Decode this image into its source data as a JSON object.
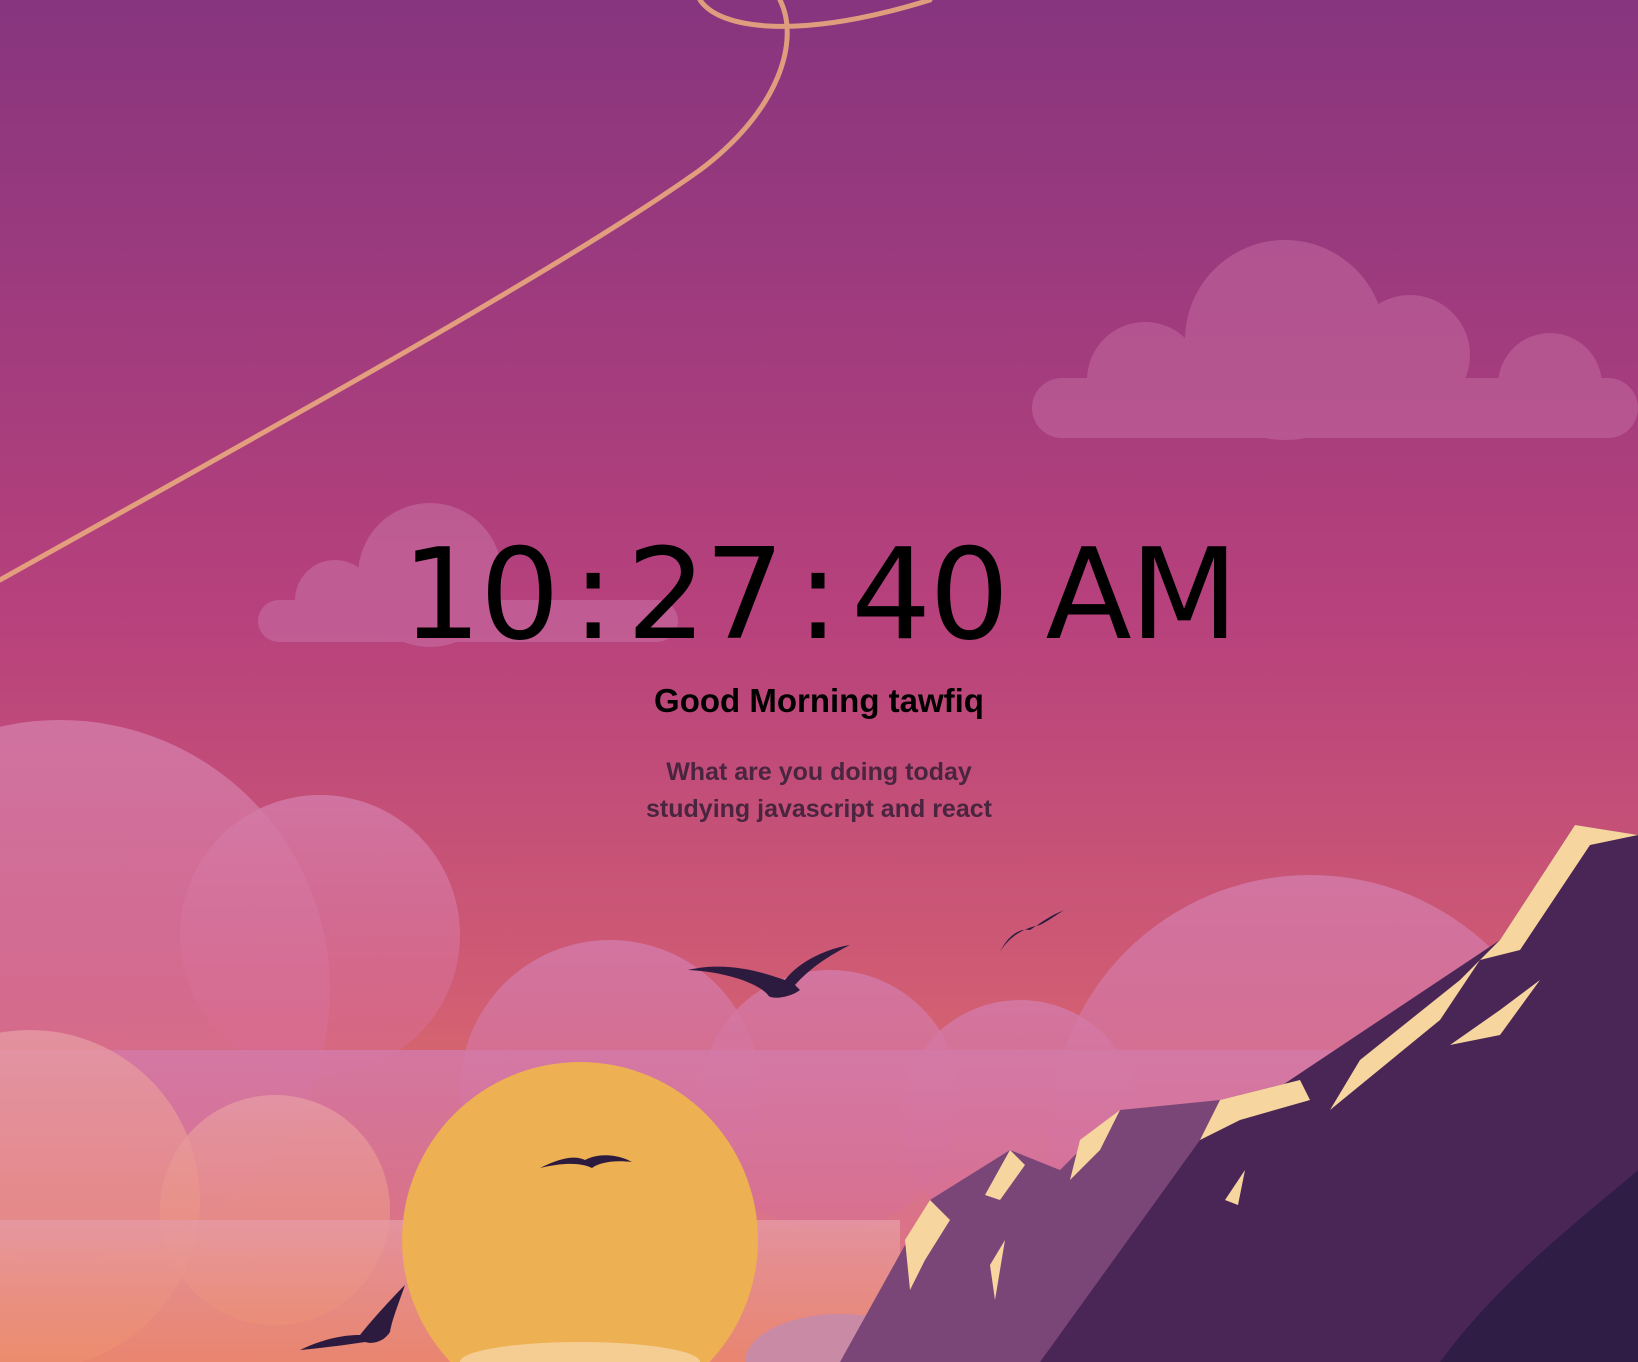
{
  "clock": {
    "hours": "10",
    "separator": ":",
    "minutes": "27",
    "seconds": "40",
    "period": "AM"
  },
  "greeting": "Good Morning tawfiq",
  "focus": {
    "question": "What are you doing today",
    "answer": "studying javascript and react"
  },
  "colors": {
    "sky_top": "#87357f",
    "sky_mid": "#b8417c",
    "sky_low": "#d66872",
    "horizon": "#ec8a5c",
    "sun": "#edb052",
    "mountain_dark": "#4a2656",
    "mountain_mid": "#7a4678",
    "snow": "#f7d59e",
    "bird": "#2c1b3f",
    "kite_string": "#e9a87e"
  }
}
